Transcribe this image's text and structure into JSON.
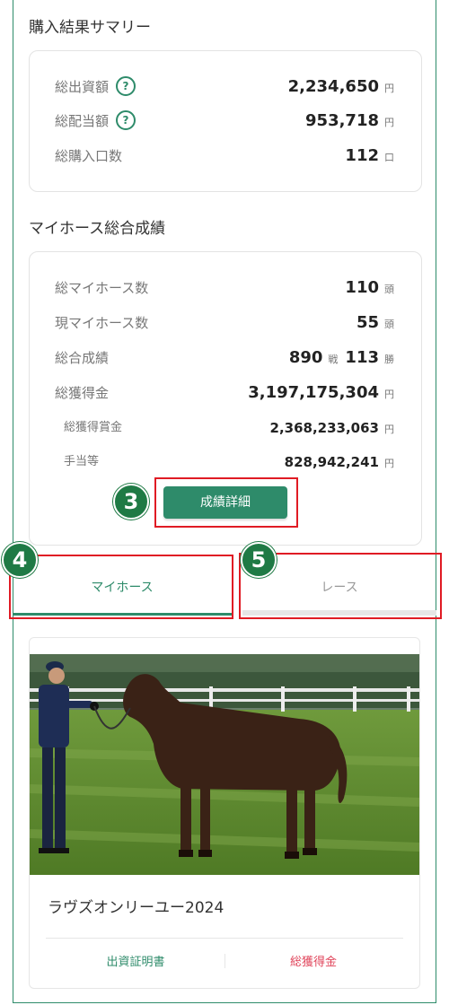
{
  "summary": {
    "title": "購入結果サマリー",
    "rows": [
      {
        "label": "総出資額",
        "value": "2,234,650",
        "unit": "円",
        "help": "?"
      },
      {
        "label": "総配当額",
        "value": "953,718",
        "unit": "円",
        "help": "?"
      },
      {
        "label": "総購入口数",
        "value": "112",
        "unit": "口"
      }
    ]
  },
  "results": {
    "title": "マイホース総合成績",
    "rows": [
      {
        "label": "総マイホース数",
        "value": "110",
        "unit": "頭"
      },
      {
        "label": "現マイホース数",
        "value": "55",
        "unit": "頭"
      },
      {
        "label": "総合成績",
        "value": "890",
        "unit": "戦",
        "value2": "113",
        "unit2": "勝"
      },
      {
        "label": "総獲得金",
        "value": "3,197,175,304",
        "unit": "円"
      },
      {
        "label": "総獲得賞金",
        "value": "2,368,233,063",
        "unit": "円"
      },
      {
        "label": "手当等",
        "value": "828,942,241",
        "unit": "円"
      }
    ],
    "detail_button": "成績詳細"
  },
  "tabs": {
    "myhorse": "マイホース",
    "race": "レース"
  },
  "annotations": [
    "3",
    "4",
    "5"
  ],
  "horse": {
    "name": "ラヴズオンリーユー2024",
    "link_certificate": "出資証明書",
    "link_earnings": "総獲得金"
  },
  "colors": {
    "accent": "#2e8b6a",
    "annotation": "#e01b24",
    "badge": "#1f7a45",
    "earnings_link": "#e0445a"
  }
}
